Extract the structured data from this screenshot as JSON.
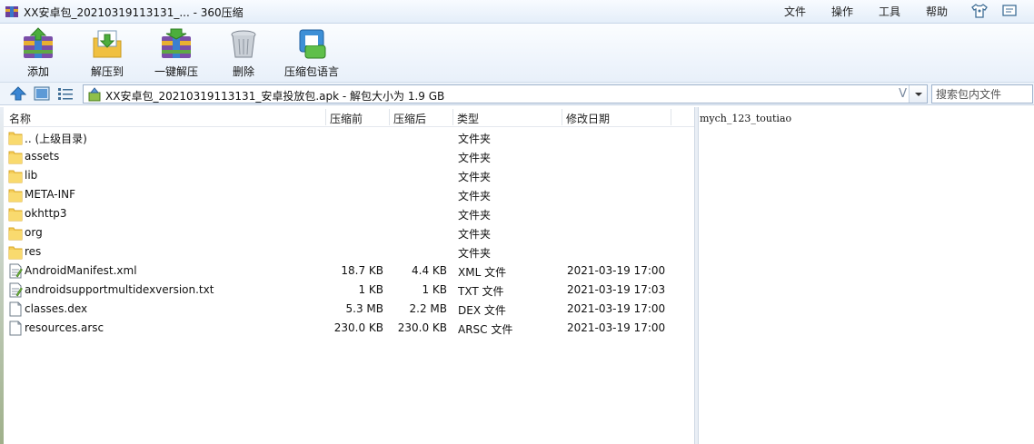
{
  "window": {
    "title": "XX安卓包_20210319113131_... - 360压缩",
    "menu": [
      "文件",
      "操作",
      "工具",
      "帮助"
    ],
    "title_icons": [
      "shirt-icon",
      "message-icon"
    ]
  },
  "toolbar": {
    "buttons": [
      {
        "label": "添加",
        "icon": "add-archive-icon"
      },
      {
        "label": "解压到",
        "icon": "extract-to-icon"
      },
      {
        "label": "一键解压",
        "icon": "one-click-extract-icon"
      },
      {
        "label": "删除",
        "icon": "trash-icon"
      },
      {
        "label": "压缩包语言",
        "icon": "archive-language-icon"
      }
    ]
  },
  "address": {
    "path": "XX安卓包_20210319113131_安卓投放包.apk - 解包大小为 1.9 GB",
    "v_glyph": "V",
    "search_placeholder": "搜索包内文件"
  },
  "table": {
    "columns": [
      "名称",
      "压缩前",
      "压缩后",
      "类型",
      "修改日期"
    ],
    "rows": [
      {
        "name": ".. (上级目录)",
        "before": "",
        "after": "",
        "type": "文件夹",
        "date": "",
        "icon": "folder-icon"
      },
      {
        "name": "assets",
        "before": "",
        "after": "",
        "type": "文件夹",
        "date": "",
        "icon": "folder-icon"
      },
      {
        "name": "lib",
        "before": "",
        "after": "",
        "type": "文件夹",
        "date": "",
        "icon": "folder-icon"
      },
      {
        "name": "META-INF",
        "before": "",
        "after": "",
        "type": "文件夹",
        "date": "",
        "icon": "folder-icon"
      },
      {
        "name": "okhttp3",
        "before": "",
        "after": "",
        "type": "文件夹",
        "date": "",
        "icon": "folder-icon"
      },
      {
        "name": "org",
        "before": "",
        "after": "",
        "type": "文件夹",
        "date": "",
        "icon": "folder-icon"
      },
      {
        "name": "res",
        "before": "",
        "after": "",
        "type": "文件夹",
        "date": "",
        "icon": "folder-icon"
      },
      {
        "name": "AndroidManifest.xml",
        "before": "18.7 KB",
        "after": "4.4 KB",
        "type": "XML 文件",
        "date": "2021-03-19 17:00",
        "icon": "text-file-icon"
      },
      {
        "name": "androidsupportmultidexversion.txt",
        "before": "1 KB",
        "after": "1 KB",
        "type": "TXT 文件",
        "date": "2021-03-19 17:03",
        "icon": "text-file-icon"
      },
      {
        "name": "classes.dex",
        "before": "5.3 MB",
        "after": "2.2 MB",
        "type": "DEX 文件",
        "date": "2021-03-19 17:00",
        "icon": "blank-file-icon"
      },
      {
        "name": "resources.arsc",
        "before": "230.0 KB",
        "after": "230.0 KB",
        "type": "ARSC 文件",
        "date": "2021-03-19 17:00",
        "icon": "blank-file-icon"
      }
    ]
  },
  "preview": {
    "text": "mych_123_toutiao"
  }
}
